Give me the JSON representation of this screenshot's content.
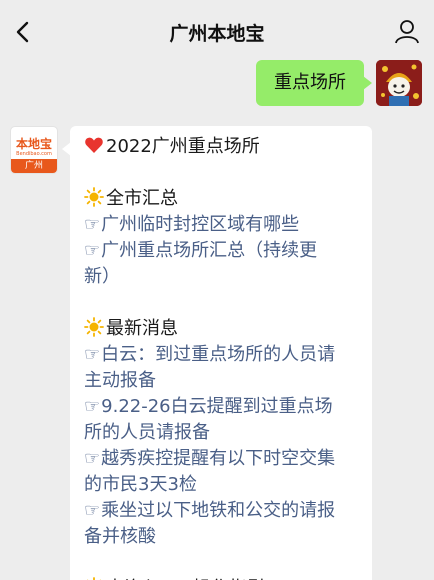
{
  "nav": {
    "title": "广州本地宝"
  },
  "outgoing": {
    "text": "重点场所"
  },
  "bot": {
    "logo_text": "本地宝",
    "logo_sub": "Bendibao.com",
    "logo_band": "广州"
  },
  "message": {
    "title": "2022广州重点场所",
    "sections": [
      {
        "heading": "全市汇总",
        "links": [
          [
            "广州临时封控区域有哪些"
          ],
          [
            "广州重点场所汇总（持续更",
            "新）"
          ]
        ]
      },
      {
        "heading": "最新消息",
        "links": [
          [
            "白云：到过重点场所的人员请",
            "主动报备"
          ],
          [
            "9.22-26白云提醒到过重点场",
            "所的人员请报备"
          ],
          [
            "越秀疾控提醒有以下时空交集",
            "的市民3天3检"
          ],
          [
            "乘坐过以下地铁和公交的请报",
            "备并核酸"
          ]
        ]
      },
      {
        "heading": "查询入口+操作指引",
        "links": []
      }
    ],
    "hand_glyph": "☞"
  },
  "icons": {
    "back": "chevron-left-icon",
    "user": "user-icon",
    "heart": "heart-icon",
    "sun": "sun-icon"
  },
  "colors": {
    "bubble_out": "#95ec69",
    "link": "#4a5f87",
    "logo": "#e8581c"
  }
}
